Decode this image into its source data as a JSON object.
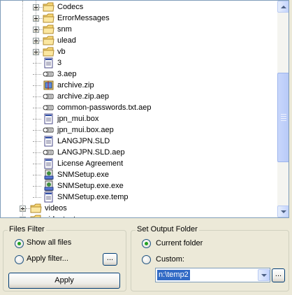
{
  "tree": {
    "folders_top": [
      {
        "label": "Codecs",
        "icon": "folder-icon"
      },
      {
        "label": "ErrorMessages",
        "icon": "folder-icon"
      },
      {
        "label": "snm",
        "icon": "folder-icon"
      },
      {
        "label": "ulead",
        "icon": "folder-icon"
      },
      {
        "label": "vb",
        "icon": "folder-icon"
      }
    ],
    "files": [
      {
        "label": "3",
        "icon": "file-icon"
      },
      {
        "label": "3.aep",
        "icon": "file-link-icon"
      },
      {
        "label": "archive.zip",
        "icon": "zip-icon"
      },
      {
        "label": "archive.zip.aep",
        "icon": "file-link-icon"
      },
      {
        "label": "common-passwords.txt.aep",
        "icon": "file-link-icon"
      },
      {
        "label": "jpn_mui.box",
        "icon": "file-icon"
      },
      {
        "label": "jpn_mui.box.aep",
        "icon": "file-link-icon"
      },
      {
        "label": "LANGJPN.SLD",
        "icon": "file-icon"
      },
      {
        "label": "LANGJPN.SLD.aep",
        "icon": "file-link-icon"
      },
      {
        "label": "License Agreement",
        "icon": "file-icon"
      },
      {
        "label": "SNMSetup.exe",
        "icon": "exe-icon"
      },
      {
        "label": "SNMSetup.exe.exe",
        "icon": "exe-icon"
      },
      {
        "label": "SNMSetup.exe.temp",
        "icon": "file-icon"
      }
    ],
    "folders_bottom": [
      {
        "label": "videos",
        "icon": "folder-icon"
      },
      {
        "label": "videotest",
        "icon": "folder-icon"
      }
    ]
  },
  "files_filter": {
    "title": "Files Filter",
    "show_all_label": "Show all files",
    "apply_filter_label": "Apply filter...",
    "browse_label": "...",
    "apply_button": "Apply",
    "selected": "show_all"
  },
  "output_folder": {
    "title": "Set Output Folder",
    "current_label": "Current folder",
    "custom_label": "Custom:",
    "custom_value": "n:\\temp2",
    "browse_label": "...",
    "selected": "current"
  },
  "colors": {
    "selection": "#316AC5",
    "folder": "#F7D674",
    "accent_border": "#003C74"
  }
}
